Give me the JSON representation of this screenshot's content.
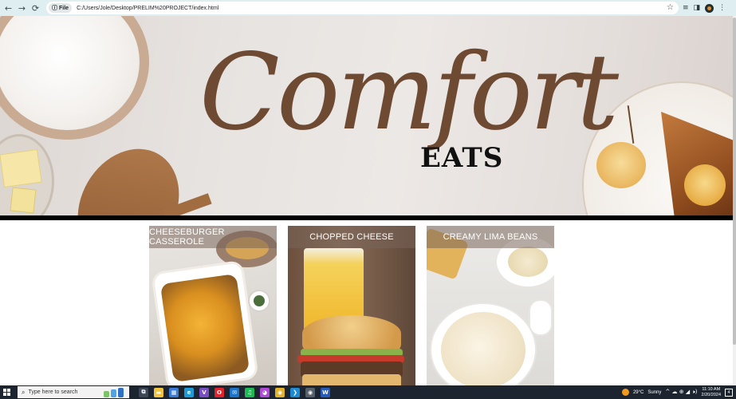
{
  "browser": {
    "back_icon": "←",
    "forward_icon": "→",
    "reload_icon": "⟳",
    "chip_icon": "ⓘ",
    "chip_label": "File",
    "url": "C:/Users/Jole/Desktop/PRELIM%20PROJECT/index.html",
    "bookmark_icon": "☆",
    "tool_icons": [
      "≡",
      "◨"
    ],
    "menu_icon": "⋮"
  },
  "banner": {
    "logo_script": "Comfort",
    "logo_sub": "EATS",
    "colors": {
      "script": "#6f4a33",
      "sub": "#111111"
    }
  },
  "recipes": [
    {
      "title": "CHEESEBURGER CASSEROLE"
    },
    {
      "title": "CHOPPED CHEESE"
    },
    {
      "title": "CREAMY LIMA BEANS"
    }
  ],
  "taskbar": {
    "search_icon": "⌕",
    "search_placeholder": "Type here to search",
    "apps": [
      {
        "name": "task-view",
        "glyph": "⧉",
        "color": "#3b4656"
      },
      {
        "name": "file-explorer",
        "glyph": "▬",
        "color": "#f2c341"
      },
      {
        "name": "store",
        "glyph": "▦",
        "color": "#3a7bd5"
      },
      {
        "name": "edge",
        "glyph": "e",
        "color": "#1e9ad6"
      },
      {
        "name": "visual-studio",
        "glyph": "V",
        "color": "#7a4fc4"
      },
      {
        "name": "opera",
        "glyph": "O",
        "color": "#e0242d"
      },
      {
        "name": "mail",
        "glyph": "✉",
        "color": "#1d73c8"
      },
      {
        "name": "spotify",
        "glyph": "♫",
        "color": "#1db954"
      },
      {
        "name": "messenger",
        "glyph": "◕",
        "color": "#b04bd8"
      },
      {
        "name": "chrome",
        "glyph": "◉",
        "color": "#e1b22a"
      },
      {
        "name": "vscode",
        "glyph": "❯",
        "color": "#1f8ad2"
      },
      {
        "name": "chrome-active",
        "glyph": "◉",
        "color": "#55606c"
      },
      {
        "name": "word",
        "glyph": "W",
        "color": "#2b5bb8"
      }
    ],
    "weather_temp": "29°C",
    "weather_text": "Sunny",
    "tray_icons": "^ ☁ ⊕ ◢ 🕨)",
    "time": "11:10 AM",
    "date": "2/20/2024",
    "notification_count": "4"
  }
}
